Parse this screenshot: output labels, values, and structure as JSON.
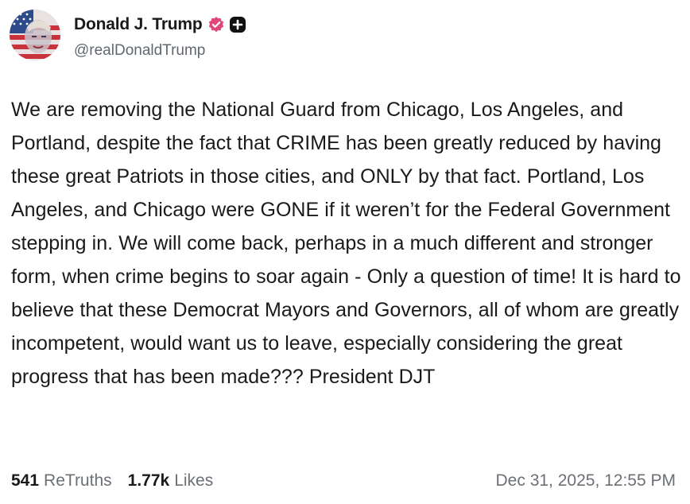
{
  "author": {
    "display_name": "Donald J. Trump",
    "handle": "@realDonaldTrump",
    "verified_icon": "verified-badge-icon",
    "plus_icon": "plus-badge-icon",
    "verified_color": "#e0457b"
  },
  "post": {
    "text": "We are removing the National Guard from Chicago, Los Angeles, and Portland, despite the fact that CRIME has been greatly reduced by having these great Patriots in those cities, and ONLY by that fact. Portland, Los Angeles, and Chicago were GONE if it weren’t for the Federal Government stepping in. We will come back, perhaps in a much different and stronger form, when crime begins to soar again - Only a question of time! It is hard to believe that these Democrat Mayors and Governors, all of whom are greatly incompetent, would want us to leave, especially considering the great progress that has been made??? President DJT"
  },
  "stats": {
    "retruths_count": "541",
    "retruths_label": "ReTruths",
    "likes_count": "1.77k",
    "likes_label": "Likes"
  },
  "timestamp": "Dec 31, 2025, 12:55 PM"
}
